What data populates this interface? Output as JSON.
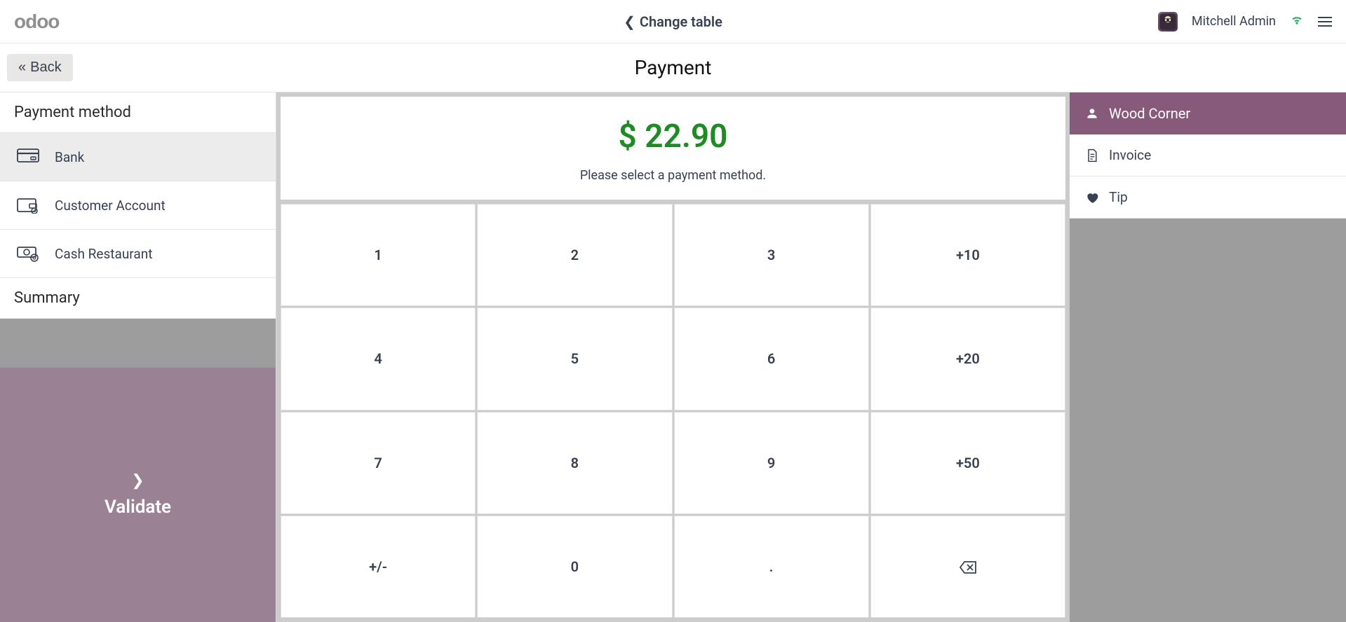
{
  "header": {
    "logo": "odoo",
    "change_table": "Change table",
    "username": "Mitchell Admin"
  },
  "subheader": {
    "back": "Back",
    "title": "Payment"
  },
  "left": {
    "methods_header": "Payment method",
    "methods": [
      {
        "label": "Bank",
        "selected": true
      },
      {
        "label": "Customer Account",
        "selected": false
      },
      {
        "label": "Cash Restaurant",
        "selected": false
      }
    ],
    "summary_header": "Summary",
    "validate": "Validate"
  },
  "center": {
    "amount": "$ 22.90",
    "message": "Please select a payment method.",
    "keys": [
      "1",
      "2",
      "3",
      "+10",
      "4",
      "5",
      "6",
      "+20",
      "7",
      "8",
      "9",
      "+50",
      "+/-",
      "0",
      ".",
      "⌫"
    ]
  },
  "right": {
    "customer": "Wood Corner",
    "invoice": "Invoice",
    "tip": "Tip"
  }
}
